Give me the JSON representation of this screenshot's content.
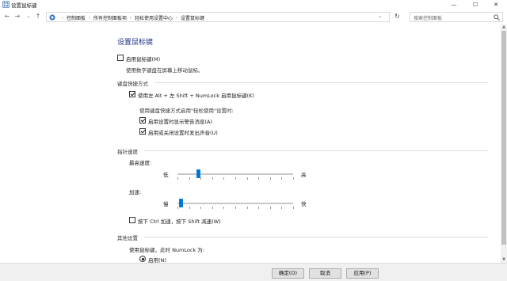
{
  "window": {
    "title": "设置鼠标键",
    "min_glyph": "—",
    "max_glyph": "☐",
    "close_glyph": "✕"
  },
  "nav": {
    "back_glyph": "←",
    "forward_glyph": "→",
    "dropdown_glyph": "⌄",
    "up_glyph": "↑",
    "breadcrumbs": [
      "控制面板",
      "所有控制面板项",
      "轻松使用设置中心",
      "设置鼠标键"
    ],
    "address_dropdown_glyph": "⌄",
    "refresh_glyph": "↻",
    "search_placeholder": "搜索控制面板"
  },
  "main": {
    "page_title": "设置鼠标键",
    "enable_mousekeys": {
      "label": "启用鼠标键(M)",
      "checked": false
    },
    "enable_description": "使用数字键盘在屏幕上移动鼠标。",
    "shortcut_section": "键盘快捷方式",
    "shortcut_checkbox": {
      "label": "使用左 Alt + 左 Shift + NumLock 启用鼠标键(K)",
      "checked": true
    },
    "shortcut_when_label": "使用键盘快捷方式启用\"轻松使用\"设置时:",
    "warning_checkbox": {
      "label": "启用设置时显示警告消息(A)",
      "checked": true
    },
    "sound_checkbox": {
      "label": "启用或关闭设置时发出声音(U)",
      "checked": true
    },
    "pointer_section": "指针速度",
    "top_speed": {
      "label": "最高速度:",
      "low": "低",
      "high": "高",
      "value_fraction": 0.18
    },
    "acceleration": {
      "label": "加速:",
      "slow": "慢",
      "fast": "快",
      "value_fraction": 0.03
    },
    "ctrl_shift_checkbox": {
      "label": "按下 Ctrl 加速，按下 Shift 减速(W)",
      "checked": false
    },
    "other_section": "其他设置",
    "numlock_label": "使用鼠标键，此时 NumLock 为:",
    "numlock_on": {
      "label": "启用(N)",
      "selected": true
    }
  },
  "footer": {
    "ok_label": "确定(O)",
    "cancel_label": "取消",
    "apply_label": "应用(P)"
  },
  "colors": {
    "heading": "#1e3287",
    "slider_thumb": "#0078d7"
  }
}
